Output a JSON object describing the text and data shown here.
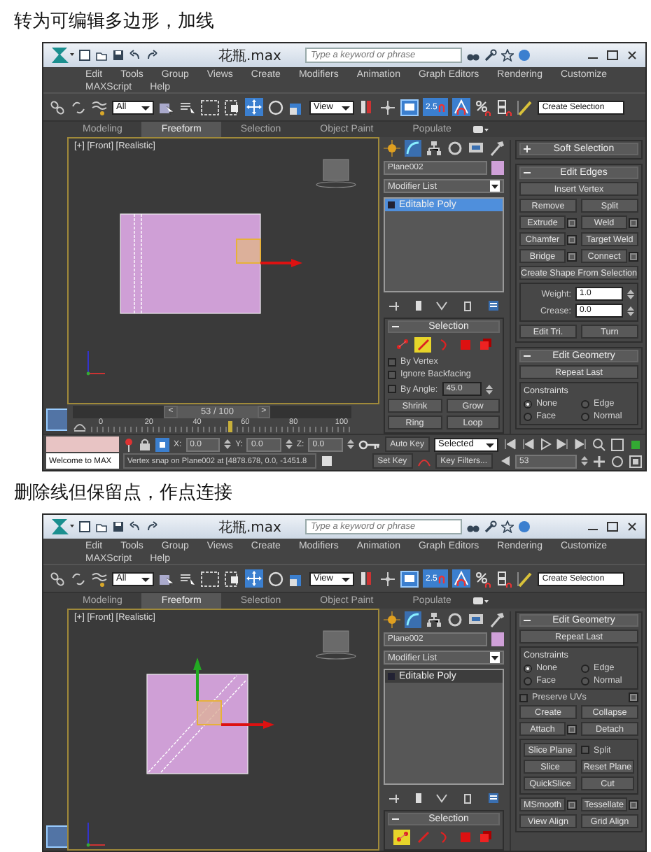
{
  "sections": [
    {
      "caption": "转为可编辑多边形，加线",
      "window": {
        "title": "花瓶.max",
        "search_placeholder": "Type a keyword or phrase",
        "menu_rows": [
          [
            "Edit",
            "Tools",
            "Group",
            "Views",
            "Create",
            "Modifiers",
            "Animation",
            "Graph Editors",
            "Rendering",
            "Customize"
          ],
          [
            "MAXScript",
            "Help"
          ]
        ],
        "selection_filter": "All",
        "coordinate_system": "View",
        "snap_label": "2.5",
        "named_selection": "Create Selection",
        "ribbon_tabs": [
          {
            "label": "Modeling",
            "selected": false
          },
          {
            "label": "Freeform",
            "selected": true
          },
          {
            "label": "Selection",
            "selected": false
          },
          {
            "label": "Object Paint",
            "selected": false
          },
          {
            "label": "Populate",
            "selected": false
          }
        ],
        "viewport": {
          "label": "[+] [Front] [Realistic]",
          "objects": [
            {
              "kind": "vertical-edges"
            }
          ]
        },
        "command_panel": {
          "object_name": "Plane002",
          "modifier_list": "Modifier List",
          "stack": [
            {
              "label": "Editable Poly",
              "selected": true
            }
          ],
          "selection_rollout": {
            "title": "Selection",
            "levels": [
              {
                "kind": "vertex",
                "selected": false
              },
              {
                "kind": "edge",
                "selected": true
              },
              {
                "kind": "border",
                "selected": false
              },
              {
                "kind": "polygon",
                "selected": false
              },
              {
                "kind": "element",
                "selected": false
              }
            ],
            "options": [
              {
                "label": "By Vertex",
                "checked": false
              },
              {
                "label": "Ignore Backfacing",
                "checked": false
              },
              {
                "label": "By Angle:",
                "checked": false,
                "value": "45.0"
              }
            ],
            "button_rows": [
              [
                "Shrink",
                "Grow"
              ],
              [
                "Ring",
                "Loop"
              ]
            ]
          },
          "rollouts": [
            {
              "title": "Soft Selection",
              "expanded": false
            },
            {
              "title": "Edit Edges",
              "expanded": true,
              "rows": [
                {
                  "kind": "row",
                  "items": [
                    {
                      "kind": "button",
                      "label": "Insert Vertex",
                      "settings": false
                    }
                  ]
                },
                {
                  "kind": "row",
                  "items": [
                    {
                      "kind": "button",
                      "label": "Remove",
                      "settings": false
                    },
                    {
                      "kind": "button",
                      "label": "Split",
                      "settings": false
                    }
                  ]
                },
                {
                  "kind": "row",
                  "items": [
                    {
                      "kind": "button",
                      "label": "Extrude",
                      "settings": true
                    },
                    {
                      "kind": "button",
                      "label": "Weld",
                      "settings": true
                    }
                  ]
                },
                {
                  "kind": "row",
                  "items": [
                    {
                      "kind": "button",
                      "label": "Chamfer",
                      "settings": true
                    },
                    {
                      "kind": "button",
                      "label": "Target Weld",
                      "settings": false
                    }
                  ]
                },
                {
                  "kind": "row",
                  "items": [
                    {
                      "kind": "button",
                      "label": "Bridge",
                      "settings": true
                    },
                    {
                      "kind": "button",
                      "label": "Connect",
                      "settings": true
                    }
                  ]
                },
                {
                  "kind": "row",
                  "items": [
                    {
                      "kind": "button",
                      "label": "Create Shape From Selection",
                      "settings": false
                    }
                  ]
                },
                {
                  "kind": "group",
                  "rows": [
                    {
                      "kind": "row",
                      "items": [
                        {
                          "kind": "spinner",
                          "label": "Weight:",
                          "value": "1.0"
                        }
                      ]
                    },
                    {
                      "kind": "row",
                      "items": [
                        {
                          "kind": "spinner",
                          "label": "Crease:",
                          "value": "0.0"
                        }
                      ]
                    }
                  ]
                },
                {
                  "kind": "row",
                  "items": [
                    {
                      "kind": "button",
                      "label": "Edit Tri.",
                      "settings": false
                    },
                    {
                      "kind": "button",
                      "label": "Turn",
                      "settings": false
                    }
                  ]
                }
              ]
            },
            {
              "title": "Edit Geometry",
              "expanded": true,
              "rows": [
                {
                  "kind": "row",
                  "items": [
                    {
                      "kind": "button",
                      "label": "Repeat Last",
                      "settings": false
                    }
                  ]
                },
                {
                  "kind": "group",
                  "title": "Constraints",
                  "rows": [
                    {
                      "kind": "row",
                      "items": [
                        {
                          "kind": "radio",
                          "label": "None",
                          "selected": true
                        },
                        {
                          "kind": "radio",
                          "label": "Edge",
                          "selected": false
                        }
                      ]
                    },
                    {
                      "kind": "row",
                      "items": [
                        {
                          "kind": "radio",
                          "label": "Face",
                          "selected": false
                        },
                        {
                          "kind": "radio",
                          "label": "Normal",
                          "selected": false
                        }
                      ]
                    }
                  ]
                }
              ]
            }
          ]
        },
        "timeline": {
          "previous": "<",
          "position": "53 / 100",
          "next": ">",
          "level": 0.53,
          "ticks": [
            "0",
            "20",
            "40",
            "60",
            "80",
            "100"
          ]
        },
        "status": {
          "listener": "Welcome to MAX",
          "prompt": "Vertex snap on Plane002 at [4878.678, 0.0, -1451.8",
          "coordinates": [
            {
              "axis": "X:",
              "value": "0.0"
            },
            {
              "axis": "Y:",
              "value": "0.0"
            },
            {
              "axis": "Z:",
              "value": "0.0"
            }
          ],
          "auto_key": "Auto Key",
          "key_mode": "Selected",
          "set_key": "Set Key",
          "key_filters": "Key Filters...",
          "frame": "53"
        }
      }
    },
    {
      "caption": "删除线但保留点，作点连接",
      "window": {
        "title": "花瓶.max",
        "search_placeholder": "Type a keyword or phrase",
        "menu_rows": [
          [
            "Edit",
            "Tools",
            "Group",
            "Views",
            "Create",
            "Modifiers",
            "Animation",
            "Graph Editors",
            "Rendering",
            "Customize"
          ],
          [
            "MAXScript",
            "Help"
          ]
        ],
        "selection_filter": "All",
        "coordinate_system": "View",
        "snap_label": "2.5",
        "named_selection": "Create Selection",
        "ribbon_tabs": [
          {
            "label": "Modeling",
            "selected": false
          },
          {
            "label": "Freeform",
            "selected": true
          },
          {
            "label": "Selection",
            "selected": false
          },
          {
            "label": "Object Paint",
            "selected": false
          },
          {
            "label": "Populate",
            "selected": false
          }
        ],
        "viewport": {
          "label": "[+] [Front] [Realistic]",
          "objects": [
            {
              "kind": "diagonal-edges"
            }
          ]
        },
        "command_panel": {
          "object_name": "Plane002",
          "modifier_list": "Modifier List",
          "stack": [
            {
              "label": "Editable Poly",
              "selected": false
            }
          ],
          "selection_rollout": {
            "title": "Selection",
            "levels": [
              {
                "kind": "vertex",
                "selected": true
              },
              {
                "kind": "edge",
                "selected": false
              },
              {
                "kind": "border",
                "selected": false
              },
              {
                "kind": "polygon",
                "selected": false
              },
              {
                "kind": "element",
                "selected": false
              }
            ]
          },
          "rollouts": [
            {
              "title": "Edit Geometry",
              "expanded": true,
              "rows": [
                {
                  "kind": "row",
                  "items": [
                    {
                      "kind": "button",
                      "label": "Repeat Last",
                      "settings": false
                    }
                  ]
                },
                {
                  "kind": "group",
                  "title": "Constraints",
                  "rows": [
                    {
                      "kind": "row",
                      "items": [
                        {
                          "kind": "radio",
                          "label": "None",
                          "selected": true
                        },
                        {
                          "kind": "radio",
                          "label": "Edge",
                          "selected": false
                        }
                      ]
                    },
                    {
                      "kind": "row",
                      "items": [
                        {
                          "kind": "radio",
                          "label": "Face",
                          "selected": false
                        },
                        {
                          "kind": "radio",
                          "label": "Normal",
                          "selected": false
                        }
                      ]
                    }
                  ]
                },
                {
                  "kind": "row",
                  "items": [
                    {
                      "kind": "check",
                      "label": "Preserve UVs",
                      "checked": false
                    },
                    {
                      "kind": "settings"
                    }
                  ]
                },
                {
                  "kind": "row",
                  "items": [
                    {
                      "kind": "button",
                      "label": "Create",
                      "settings": false
                    },
                    {
                      "kind": "button",
                      "label": "Collapse",
                      "settings": false
                    }
                  ]
                },
                {
                  "kind": "row",
                  "items": [
                    {
                      "kind": "button",
                      "label": "Attach",
                      "settings": true
                    },
                    {
                      "kind": "button",
                      "label": "Detach",
                      "settings": false
                    }
                  ]
                },
                {
                  "kind": "group",
                  "rows": [
                    {
                      "kind": "row",
                      "items": [
                        {
                          "kind": "button",
                          "label": "Slice Plane",
                          "settings": false
                        },
                        {
                          "kind": "check",
                          "label": "Split",
                          "checked": false
                        }
                      ]
                    },
                    {
                      "kind": "row",
                      "items": [
                        {
                          "kind": "button",
                          "label": "Slice",
                          "settings": false
                        },
                        {
                          "kind": "button",
                          "label": "Reset Plane",
                          "settings": false
                        }
                      ]
                    },
                    {
                      "kind": "row",
                      "items": [
                        {
                          "kind": "button",
                          "label": "QuickSlice",
                          "settings": false
                        },
                        {
                          "kind": "button",
                          "label": "Cut",
                          "settings": false
                        }
                      ]
                    }
                  ]
                },
                {
                  "kind": "row",
                  "items": [
                    {
                      "kind": "button",
                      "label": "MSmooth",
                      "settings": true
                    },
                    {
                      "kind": "button",
                      "label": "Tessellate",
                      "settings": true
                    }
                  ]
                },
                {
                  "kind": "row",
                  "items": [
                    {
                      "kind": "button",
                      "label": "View Align",
                      "settings": false
                    },
                    {
                      "kind": "button",
                      "label": "Grid Align",
                      "settings": false
                    }
                  ]
                }
              ]
            }
          ]
        }
      }
    }
  ]
}
